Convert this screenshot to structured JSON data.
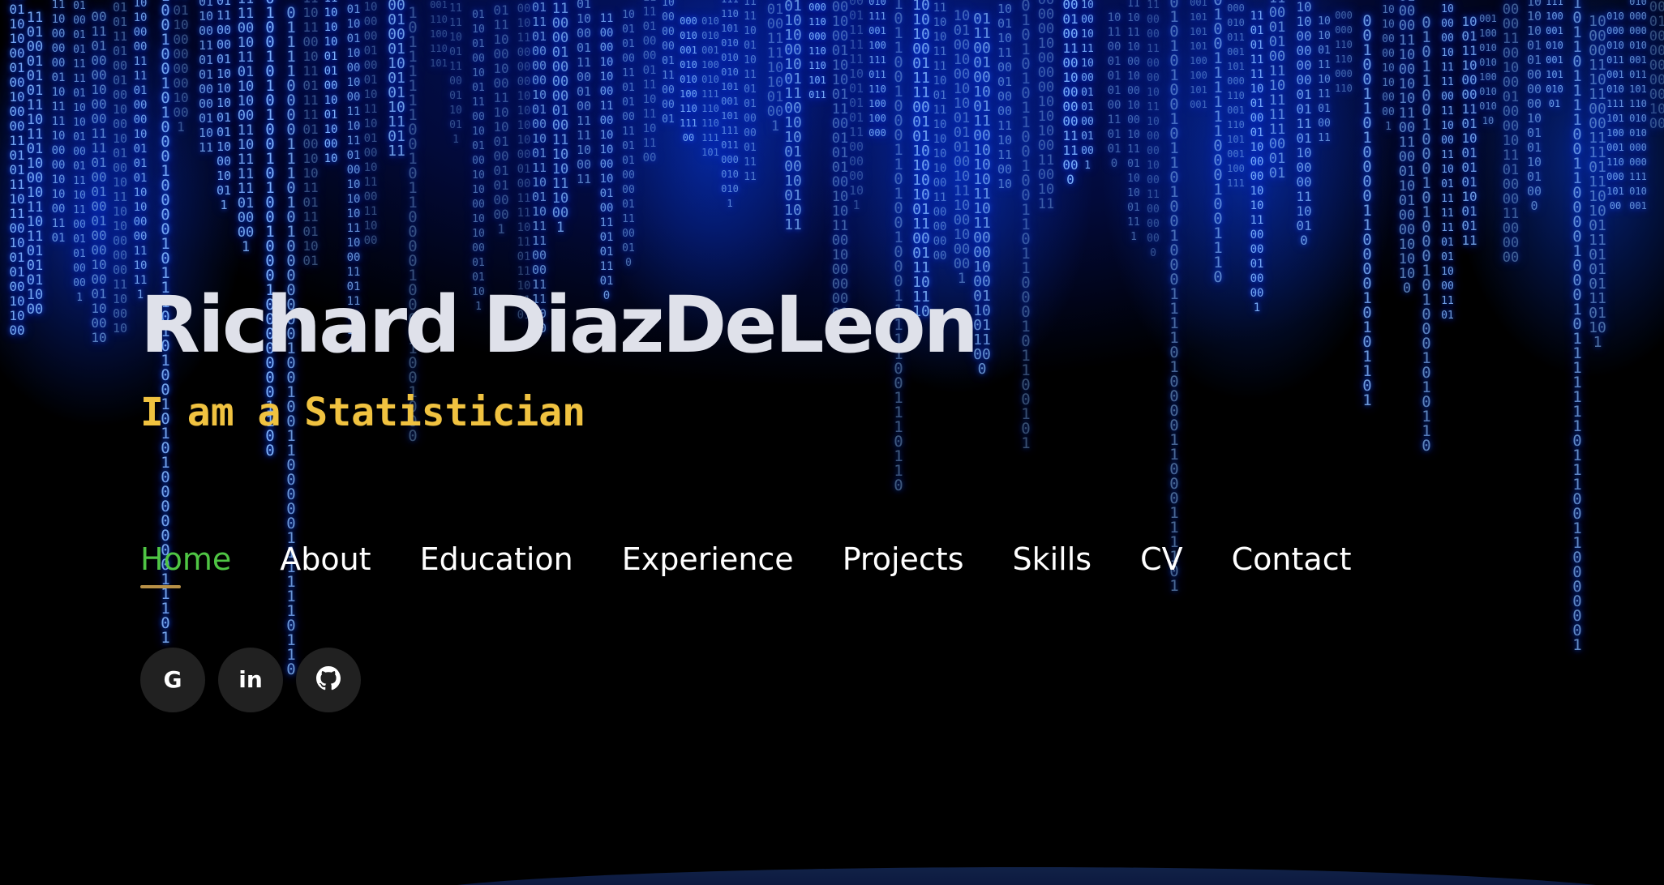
{
  "hero": {
    "name": "Richard DiazDeLeon",
    "tagline": "I am a Statistician"
  },
  "nav": {
    "items": [
      {
        "label": "Home",
        "active": true
      },
      {
        "label": "About",
        "active": false
      },
      {
        "label": "Education",
        "active": false
      },
      {
        "label": "Experience",
        "active": false
      },
      {
        "label": "Projects",
        "active": false
      },
      {
        "label": "Skills",
        "active": false
      },
      {
        "label": "CV",
        "active": false
      },
      {
        "label": "Contact",
        "active": false
      }
    ]
  },
  "socials": [
    {
      "icon": "google-icon",
      "glyph": "G"
    },
    {
      "icon": "linkedin-icon",
      "glyph": "in"
    },
    {
      "icon": "github-icon",
      "glyph": ""
    }
  ],
  "colors": {
    "name_text": "#dfe1ea",
    "tagline_text": "#f0c240",
    "nav_active": "#4fc544",
    "nav_underline": "#b89047",
    "social_button_bg": "#212121",
    "background": "#000000",
    "matrix_rain": "#7fb4ff"
  }
}
